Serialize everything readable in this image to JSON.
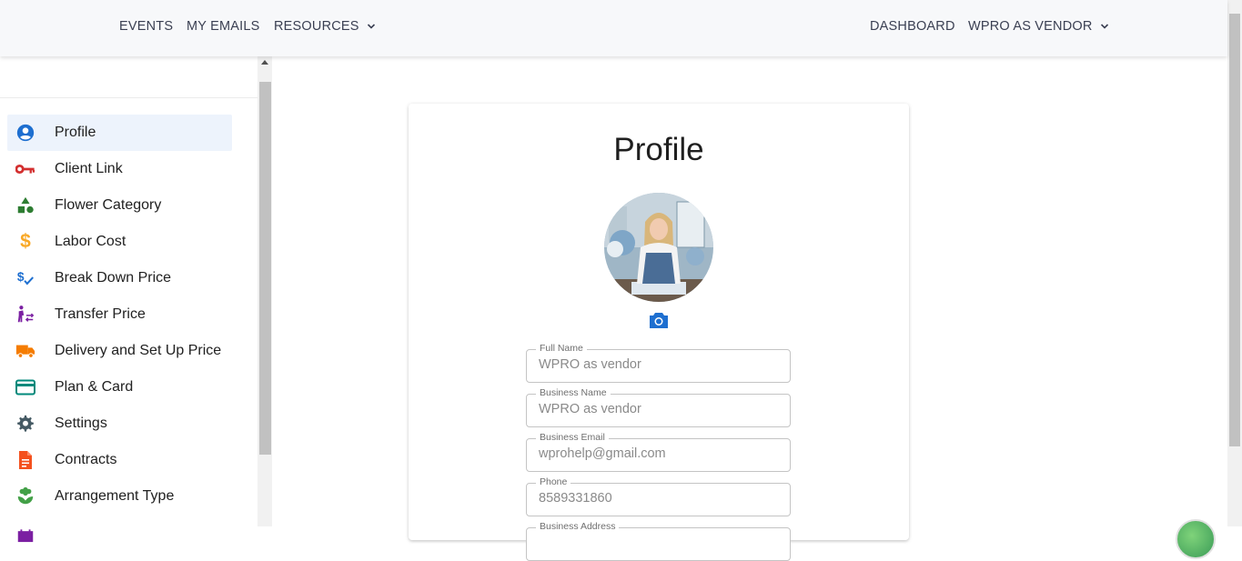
{
  "topnav": {
    "left": [
      {
        "label": "EVENTS"
      },
      {
        "label": "MY EMAILS"
      },
      {
        "label": "RESOURCES"
      }
    ],
    "right": [
      {
        "label": "DASHBOARD"
      },
      {
        "label": "WPRO AS VENDOR"
      }
    ]
  },
  "sidebar": {
    "items": [
      {
        "label": "Profile",
        "icon": "account-circle-icon",
        "color": "#1e6fd0",
        "active": true
      },
      {
        "label": "Client Link",
        "icon": "key-icon",
        "color": "#d32f2f"
      },
      {
        "label": "Flower Category",
        "icon": "category-shapes-icon",
        "color": "#2e7d32"
      },
      {
        "label": "Labor Cost",
        "icon": "dollar-icon",
        "color": "#f9a825"
      },
      {
        "label": "Break Down Price",
        "icon": "price-check-icon",
        "color": "#1e6fd0"
      },
      {
        "label": "Transfer Price",
        "icon": "transfer-person-icon",
        "color": "#7b1fa2"
      },
      {
        "label": "Delivery and Set Up Price",
        "icon": "truck-icon",
        "color": "#f57c00"
      },
      {
        "label": "Plan & Card",
        "icon": "credit-card-icon",
        "color": "#00897b"
      },
      {
        "label": "Settings",
        "icon": "gear-icon",
        "color": "#455a64"
      },
      {
        "label": "Contracts",
        "icon": "document-icon",
        "color": "#f4511e"
      },
      {
        "label": "Arrangement Type",
        "icon": "flower-icon",
        "color": "#43a047"
      }
    ]
  },
  "profile": {
    "title": "Profile",
    "fields": [
      {
        "label": "Full Name",
        "value": "WPRO as vendor"
      },
      {
        "label": "Business Name",
        "value": "WPRO as vendor"
      },
      {
        "label": "Business Email",
        "value": "wprohelp@gmail.com"
      },
      {
        "label": "Phone",
        "value": "8589331860"
      },
      {
        "label": "Business Address",
        "value": ""
      }
    ]
  }
}
